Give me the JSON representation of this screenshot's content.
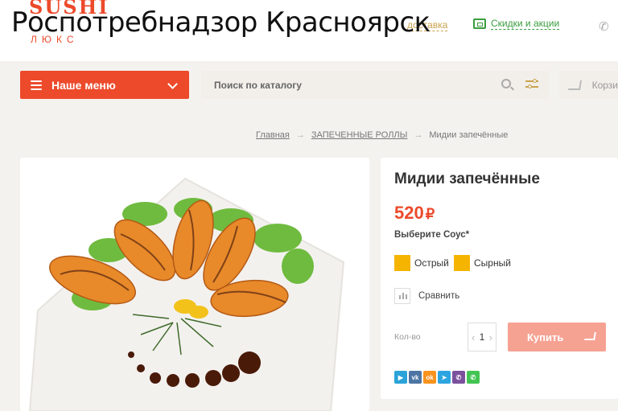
{
  "overlay": {
    "text": "Роспотребнадзор  Красноярск"
  },
  "logo": {
    "top": "SUSHI",
    "bottom": "ЛЮКС",
    "color": "#ec4a2b"
  },
  "header": {
    "delivery_link": "доставка",
    "discounts_link": "Скидки и акции",
    "phone_icon": "phone-icon"
  },
  "nav": {
    "menu_label": "Наше меню",
    "search_placeholder": "Поиск по каталогу",
    "cart_label": "Корзи"
  },
  "breadcrumb": {
    "items": [
      "Главная",
      "ЗАПЕЧЕННЫЕ РОЛЛЫ",
      "Мидии запечённые"
    ]
  },
  "product": {
    "title": "Мидии запечённые",
    "price": "520",
    "currency": "₽",
    "sauce_label": "Выберите Соус*",
    "sauce_options": [
      "Острый",
      "Сырный"
    ],
    "compare_label": "Сравнить",
    "qty_label": "Кол-во",
    "qty_value": "1",
    "qty_minus": "‹",
    "qty_plus": "›",
    "buy_label": "Купить"
  },
  "share": [
    {
      "name": "share-icon",
      "glyph": "▶",
      "color": "#2aa3d8"
    },
    {
      "name": "vk-icon",
      "glyph": "vk",
      "color": "#4c75a3"
    },
    {
      "name": "ok-icon",
      "glyph": "ok",
      "color": "#f7931e"
    },
    {
      "name": "telegram-icon",
      "glyph": "➤",
      "color": "#2ca5e0"
    },
    {
      "name": "viber-icon",
      "glyph": "✆",
      "color": "#7b519d"
    },
    {
      "name": "whatsapp-icon",
      "glyph": "✆",
      "color": "#43c553"
    }
  ],
  "colors": {
    "accent": "#ec4a2b",
    "buy_button": "#f6a293",
    "sauce_swatch": "#f5b400",
    "link_green": "#3a9d3e"
  }
}
